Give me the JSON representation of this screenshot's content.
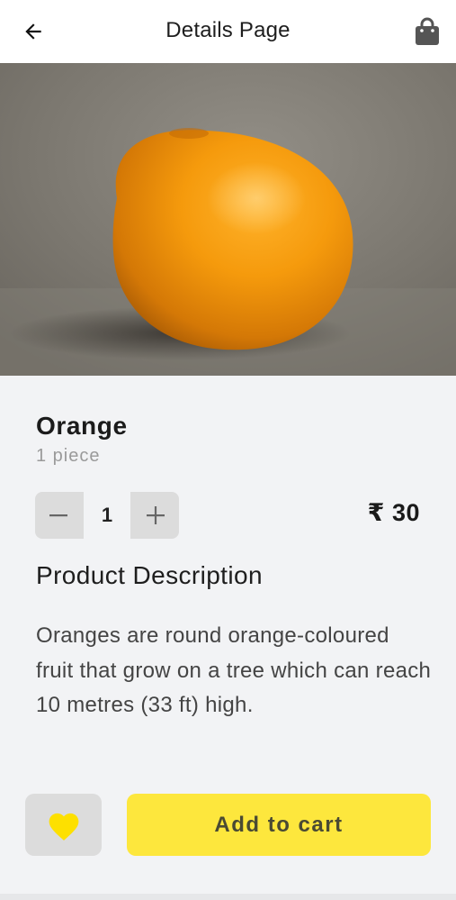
{
  "header": {
    "title": "Details Page",
    "back_icon": "arrow-left-icon",
    "bag_icon": "shopping-bag-icon"
  },
  "product": {
    "image_subject": "orange",
    "name": "Orange",
    "unit": "1 piece",
    "quantity": "1",
    "price": "₹ 30"
  },
  "stepper": {
    "minus_icon": "minus-icon",
    "plus_icon": "plus-icon"
  },
  "description": {
    "heading": "Product Description",
    "text": "Oranges are round orange-coloured fruit that grow on a tree which can reach 10 metres (33 ft) high."
  },
  "actions": {
    "favorite_icon": "heart-icon",
    "add_to_cart_label": "Add to cart"
  },
  "colors": {
    "accent_yellow": "#fde73d",
    "heart_yellow": "#fde000",
    "background": "#f2f3f5"
  }
}
